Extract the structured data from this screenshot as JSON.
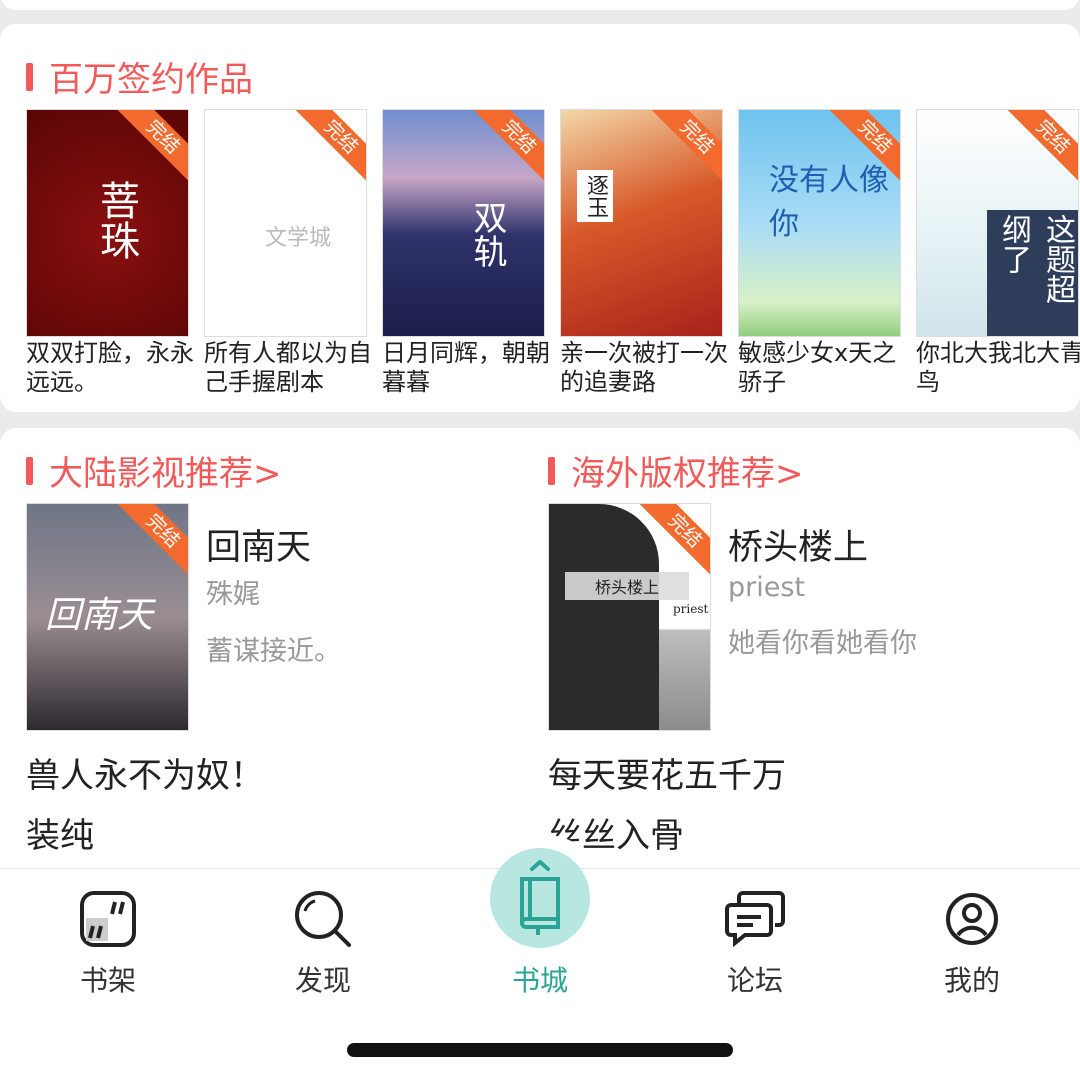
{
  "section_million": {
    "title": "百万签约作品",
    "books": [
      {
        "caption": "双双打脸，永永远远。",
        "badge": "完结",
        "cover_text": "菩珠"
      },
      {
        "caption": "所有人都以为自己手握剧本",
        "badge": "完结",
        "cover_text": "文学城"
      },
      {
        "caption": "日月同辉，朝朝暮暮",
        "badge": "完结",
        "cover_text": "双轨"
      },
      {
        "caption": "亲一次被打一次的追妻路",
        "badge": "完结",
        "cover_text": "逐玉"
      },
      {
        "caption": "敏感少女x天之骄子",
        "badge": "完结",
        "cover_text": "没有人像你"
      },
      {
        "caption": "你北大我北大青鸟",
        "badge": "完结",
        "cover_text": "这题超纲了"
      }
    ]
  },
  "section_mainland": {
    "title": "大陆影视推荐>",
    "feature": {
      "name": "回南天",
      "author": "殊娓",
      "desc": "蓄谋接近。",
      "badge": "完结",
      "cover_text": "回南天"
    },
    "list": [
      "兽人永不为奴！",
      "装纯"
    ]
  },
  "section_overseas": {
    "title": "海外版权推荐>",
    "feature": {
      "name": "桥头楼上",
      "author": "priest",
      "desc": "她看你看她看你",
      "badge": "完结",
      "cover_text": "桥头楼上",
      "cover_author": "priest"
    },
    "list": [
      "每天要花五千万",
      "丝丝入骨"
    ]
  },
  "tabbar": {
    "items": [
      {
        "label": "书架",
        "icon": "bookshelf-icon"
      },
      {
        "label": "发现",
        "icon": "search-icon"
      },
      {
        "label": "书城",
        "icon": "book-icon"
      },
      {
        "label": "论坛",
        "icon": "chat-icon"
      },
      {
        "label": "我的",
        "icon": "profile-icon"
      }
    ],
    "active_color": "#2aa495"
  },
  "colors": {
    "accent": "#f15a5a",
    "badge": "#f26a2e"
  }
}
